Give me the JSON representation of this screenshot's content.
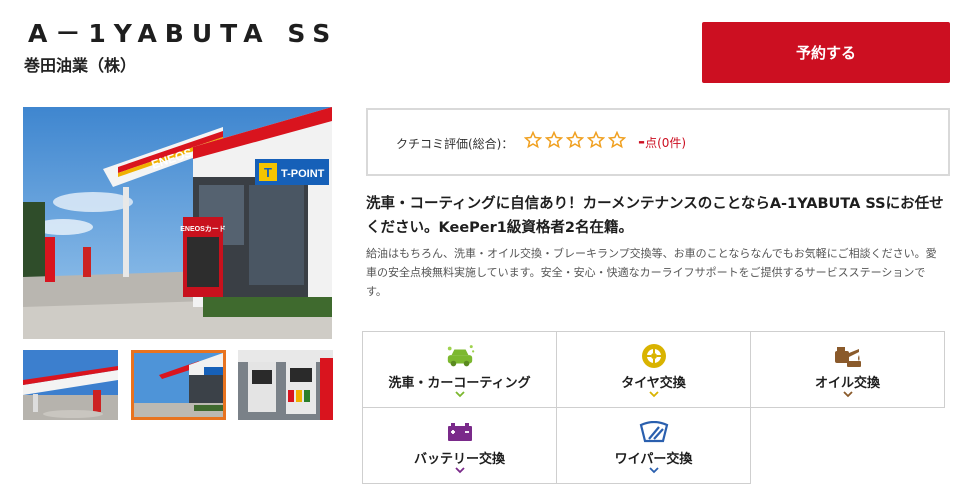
{
  "header": {
    "title": "A－1YABUTA SS",
    "subtitle": "巻田油業（株）",
    "reserve_label": "予約する"
  },
  "photos": {
    "main_signs": {
      "brand": "ENEOS",
      "card": "ENEOSカード",
      "tpoint": "T-POINT",
      "tpoint_letter": "T"
    },
    "thumb_count": 3,
    "selected_thumb": 2
  },
  "review": {
    "label": "クチコミ評価(総合)：",
    "stars_filled": 0,
    "stars_total": 5,
    "score_dash": "-",
    "score_suffix": "点(0件)"
  },
  "headline": "洗車・コーティングに自信あり！カーメンテナンスのことならA-1YABUTA SSにお任せください。KeePer1級資格者2名在籍。",
  "description": "給油はもちろん、洗車・オイル交換・ブレーキランプ交換等、お車のことならなんでもお気軽にご相談ください。愛車の安全点検無料実施しています。安全・安心・快適なカーライフサポートをご提供するサービスステーションです。",
  "services": [
    {
      "label": "洗車・カーコーティング",
      "icon": "car-wash-icon",
      "color": "#7cb82f"
    },
    {
      "label": "タイヤ交換",
      "icon": "tire-icon",
      "color": "#d9b300"
    },
    {
      "label": "オイル交換",
      "icon": "oil-can-icon",
      "color": "#8a5a2b"
    },
    {
      "label": "バッテリー交換",
      "icon": "battery-icon",
      "color": "#7a2a8a"
    },
    {
      "label": "ワイパー交換",
      "icon": "wiper-icon",
      "color": "#2a5fae"
    }
  ],
  "colors": {
    "accent": "#cc0f21",
    "star": "#f0a020",
    "thumb_selected": "#e8731f"
  }
}
